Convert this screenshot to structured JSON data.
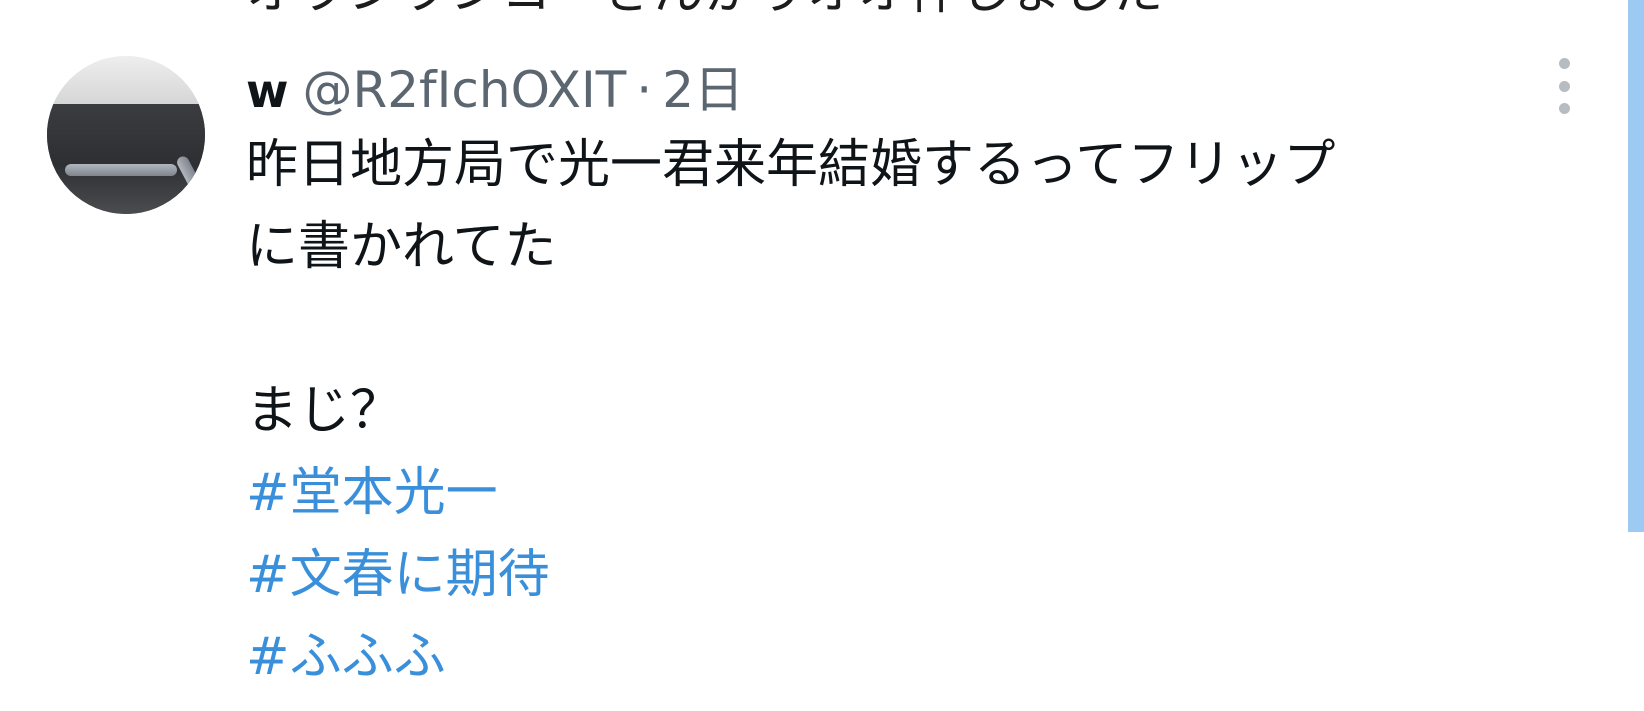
{
  "top_cut_text": "オランランコーさんがりオオ件しました",
  "tweet": {
    "author_name": "w",
    "handle": "@R2fIchOXIT",
    "separator": "·",
    "time": "2日",
    "avatar_icon": "avatar-photo",
    "more_icon": "more-vertical-icon",
    "text_lines": [
      "昨日地方局で光一君来年結婚するってフリップ",
      "に書かれてた"
    ],
    "text_after_gap": "まじ？",
    "hashtags": [
      "#堂本光一",
      "#文春に期待",
      "#ふふふ"
    ]
  },
  "colors": {
    "hashtag": "#3a8fdb",
    "secondary_text": "#5b6670",
    "scroll_accent": "#9ccaf2"
  }
}
